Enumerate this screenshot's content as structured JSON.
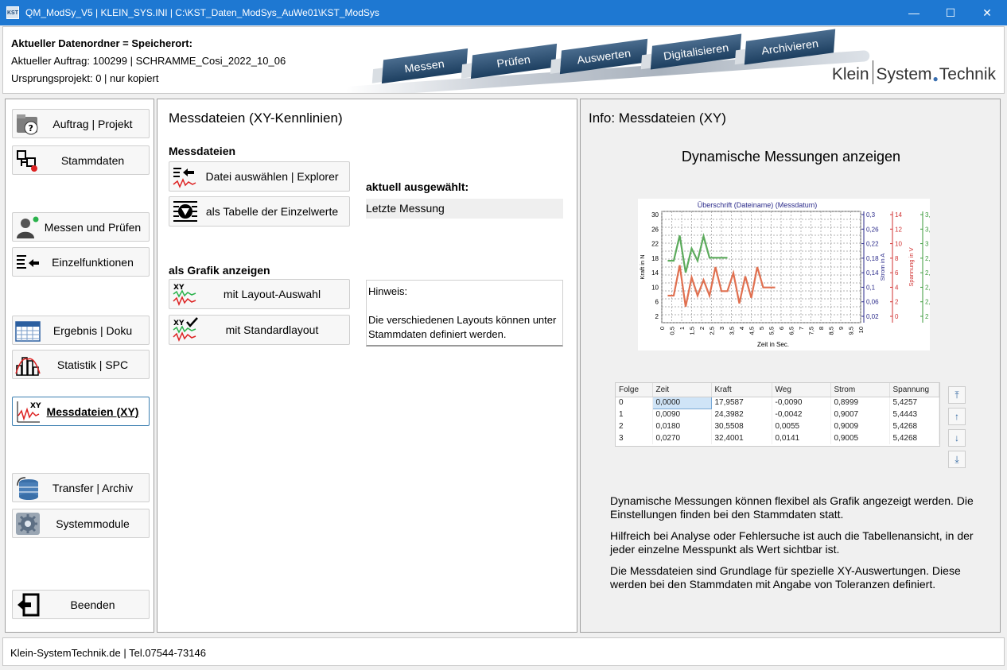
{
  "window": {
    "title": "QM_ModSy_V5  |  KLEIN_SYS.INI  |  C:\\KST_Daten_ModSys_AuWe01\\KST_ModSys",
    "app_icon_text": "KST",
    "minimize": "—",
    "maximize": "☐",
    "close": "✕"
  },
  "header": {
    "line1": "Aktueller Datenordner = Speicherort:",
    "line2": "Aktueller Auftrag: 100299 | SCHRAMME_Cosi_2022_10_06",
    "line3": "Ursprungsprojekt: 0 | nur kopiert",
    "banner": [
      "Messen",
      "Prüfen",
      "Auswerten",
      "Digitalisieren",
      "Archivieren"
    ],
    "logo": {
      "part1": "Klein",
      "part2": "System",
      "part3": "Technik"
    }
  },
  "sidebar": {
    "items": [
      {
        "label": "Auftrag | Projekt",
        "icon": "folder-question-icon"
      },
      {
        "label": "Stammdaten",
        "icon": "structure-icon"
      },
      {
        "label": "Messen und Prüfen",
        "icon": "person-icon"
      },
      {
        "label": "Einzelfunktionen",
        "icon": "list-arrow-icon"
      },
      {
        "label": "Ergebnis | Doku",
        "icon": "calendar-icon"
      },
      {
        "label": "Statistik | SPC",
        "icon": "histogram-icon"
      },
      {
        "label": "Messdateien (XY)",
        "icon": "xy-chart-icon"
      },
      {
        "label": "Transfer | Archiv",
        "icon": "database-icon"
      },
      {
        "label": "Systemmodule",
        "icon": "gear-icon"
      },
      {
        "label": "Beenden",
        "icon": "exit-icon"
      }
    ]
  },
  "main": {
    "title": "Messdateien (XY-Kennlinien)",
    "section1": "Messdateien",
    "btn_select_file": "Datei auswählen | Explorer",
    "btn_table": "als Tabelle der Einzelwerte",
    "selected_label": "aktuell ausgewählt:",
    "selected_value": "Letzte Messung",
    "section2": "als Grafik anzeigen",
    "btn_layout_select": "mit Layout-Auswahl",
    "btn_standard_layout": "mit Standardlayout",
    "hint_title": "Hinweis:",
    "hint_text": "Die verschiedenen Layouts können unter Stammdaten definiert werden."
  },
  "info": {
    "title": "Info: Messdateien (XY)",
    "subtitle": "Dynamische Messungen anzeigen",
    "chart_data": {
      "type": "line",
      "title": "Überschrift (Dateiname) (Messdatum)",
      "xlabel": "Zeit in Sec.",
      "x_ticks": [
        "0",
        "0,5",
        "1",
        "1,5",
        "2",
        "2,5",
        "3",
        "3,5",
        "4",
        "4,5",
        "5",
        "5,5",
        "6",
        "6,5",
        "7",
        "7,5",
        "8",
        "8,5",
        "9",
        "9,5",
        "10"
      ],
      "xlim": [
        0,
        10
      ],
      "y_axes": [
        {
          "label": "Kraft in N",
          "ticks": [
            "30",
            "26",
            "22",
            "18",
            "14",
            "10",
            "6",
            "2"
          ],
          "range": [
            0,
            30
          ],
          "color": "#000000"
        },
        {
          "label": "Strom in A",
          "ticks": [
            "0,3",
            "0,26",
            "0,22",
            "0,18",
            "0,14",
            "0,1",
            "0,06",
            "0,02"
          ],
          "range": [
            0,
            0.3
          ],
          "color": "#2a2a8a"
        },
        {
          "label": "Spannung in V",
          "ticks": [
            "14",
            "12",
            "10",
            "8",
            "6",
            "4",
            "2",
            "0"
          ],
          "range": [
            -1,
            15
          ],
          "color": "#d03030"
        },
        {
          "label": "Weg in mm",
          "ticks": [
            "3,4",
            "3,2",
            "3",
            "2,8",
            "2,6",
            "2,4",
            "2,2",
            "2"
          ],
          "range": [
            1.95,
            3.55
          ],
          "color": "#3a9a3a"
        }
      ],
      "series": [
        {
          "color": "#e07050",
          "axis": 0,
          "x": [
            0,
            0.3,
            0.6,
            0.9,
            1.2,
            1.5,
            1.8,
            2.1,
            2.4,
            2.7,
            3.0,
            3.3,
            3.6,
            3.9,
            4.2,
            4.5,
            4.8,
            5.1,
            5.4
          ],
          "y": [
            7.3,
            7.3,
            15.5,
            4.3,
            12.2,
            7.3,
            11.5,
            7.3,
            15,
            8.5,
            8.5,
            13.4,
            5.2,
            12.5,
            6.7,
            15,
            9.5,
            9.5,
            9.5
          ]
        },
        {
          "color": "#5cab5c",
          "axis": 0,
          "x": [
            0,
            0.3,
            0.6,
            0.9,
            1.2,
            1.5,
            1.8,
            2.1,
            2.4,
            2.7,
            3.0
          ],
          "y": [
            16.7,
            16.7,
            23.5,
            13.5,
            20,
            16.7,
            23.3,
            17.5,
            17.5,
            17.5,
            17.5
          ]
        }
      ]
    },
    "table": {
      "columns": [
        "Folge",
        "Zeit",
        "Kraft",
        "Weg",
        "Strom",
        "Spannung"
      ],
      "rows": [
        [
          "0",
          "0,0000",
          "17,9587",
          "-0,0090",
          "0,8999",
          "5,4257"
        ],
        [
          "1",
          "0,0090",
          "24,3982",
          "-0,0042",
          "0,9007",
          "5,4443"
        ],
        [
          "2",
          "0,0180",
          "30,5508",
          "0,0055",
          "0,9009",
          "5,4268"
        ],
        [
          "3",
          "0,0270",
          "32,4001",
          "0,0141",
          "0,9005",
          "5,4268"
        ]
      ],
      "nav": [
        "⤒",
        "↑",
        "↓",
        "⤓"
      ]
    },
    "paragraphs": [
      "Dynamische Messungen können flexibel als Grafik angezeigt werden. Die Einstellungen finden bei den Stammdaten statt.",
      "Hilfreich bei Analyse oder Fehlersuche ist auch die Tabellenansicht, in der jeder einzelne Messpunkt als Wert sichtbar ist.",
      "Die Messdateien sind Grundlage für spezielle XY-Auswertungen. Diese werden bei den Stammdaten mit Angabe von Toleranzen definiert."
    ]
  },
  "status": {
    "text": "Klein-SystemTechnik.de  |  Tel.07544-73146"
  }
}
